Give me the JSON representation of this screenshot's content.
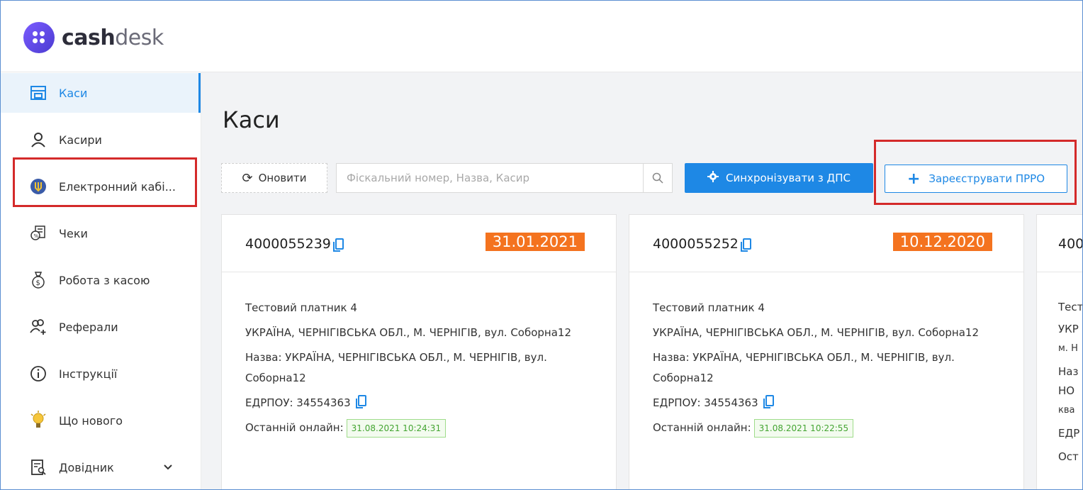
{
  "app": {
    "logo_bold": "cash",
    "logo_thin": "desk"
  },
  "sidebar": {
    "items": [
      {
        "label": "Каси",
        "icon": "cash-register-icon"
      },
      {
        "label": "Касири",
        "icon": "user-icon"
      },
      {
        "label": "Електронний кабі...",
        "icon": "ukraine-trident-icon"
      },
      {
        "label": "Чеки",
        "icon": "receipts-icon"
      },
      {
        "label": "Робота з касою",
        "icon": "money-bag-icon"
      },
      {
        "label": "Реферали",
        "icon": "add-user-icon"
      },
      {
        "label": "Інструкції",
        "icon": "info-icon"
      },
      {
        "label": "Що нового",
        "icon": "lightbulb-icon"
      },
      {
        "label": "Довідник",
        "icon": "reference-icon"
      }
    ]
  },
  "main": {
    "title": "Каси",
    "refresh_label": "Оновити",
    "search_placeholder": "Фіскальний номер, Назва, Касир",
    "sync_label": "Синхронізувати з ДПС",
    "register_label": "Зареєструвати ПРРО"
  },
  "cards": [
    {
      "fiscal_number": "4000055239",
      "date": "31.01.2021",
      "company": "Тестовий платник 4",
      "address": "УКРАЇНА, ЧЕРНІГІВСЬКА ОБЛ., М. ЧЕРНІГІВ, вул. Соборна12",
      "name": "Назва: УКРАЇНА, ЧЕРНІГІВСЬКА ОБЛ., М. ЧЕРНІГІВ, вул. Соборна12",
      "edrpou": "ЕДРПОУ: 34554363",
      "last_online_label": "Останній онлайн:",
      "last_online": "31.08.2021 10:24:31"
    },
    {
      "fiscal_number": "4000055252",
      "date": "10.12.2020",
      "company": "Тестовий платник 4",
      "address": "УКРАЇНА, ЧЕРНІГІВСЬКА ОБЛ., М. ЧЕРНІГІВ, вул. Соборна12",
      "name": "Назва: УКРАЇНА, ЧЕРНІГІВСЬКА ОБЛ., М. ЧЕРНІГІВ, вул. Соборна12",
      "edrpou": "ЕДРПОУ: 34554363",
      "last_online_label": "Останній онлайн:",
      "last_online": "31.08.2021 10:22:55"
    },
    {
      "fiscal_number": "400",
      "company": "Тест",
      "address_1": "УКР",
      "address_2": "м. Н",
      "name_1": "Наз",
      "name_2": "НО",
      "name_3": "ква",
      "edrpou": "ЕДР",
      "last_online_label": "Ост"
    }
  ],
  "colors": {
    "accent": "#1e88e5",
    "date_badge": "#f4731f",
    "online_green": "#44a532",
    "highlight_red": "#d42a2a"
  }
}
